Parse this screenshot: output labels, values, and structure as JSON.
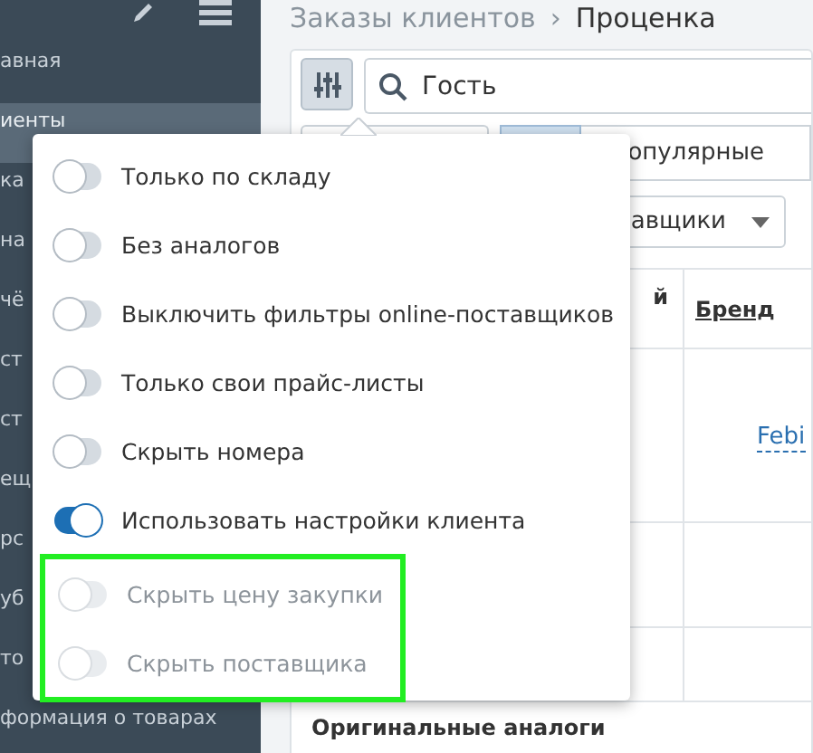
{
  "sidebar": {
    "items": [
      {
        "label": "авная",
        "selected": false
      },
      {
        "label": "иенты",
        "selected": true
      },
      {
        "label": "ка",
        "selected": false
      },
      {
        "label": "на",
        "selected": false
      },
      {
        "label": "чё",
        "selected": false
      },
      {
        "label": "ст",
        "selected": false
      },
      {
        "label": "ст",
        "selected": false
      },
      {
        "label": "ещ",
        "selected": false
      },
      {
        "label": "рс",
        "selected": false
      },
      {
        "label": "уб",
        "selected": false
      },
      {
        "label": "то",
        "selected": false
      },
      {
        "label": "формация о товарах",
        "selected": false
      }
    ]
  },
  "breadcrumb": {
    "parent": "Заказы клиентов",
    "separator": "›",
    "current": "Проценка"
  },
  "search": {
    "value": "Гость"
  },
  "tabs": [
    {
      "selected": false
    },
    {
      "selected": true
    },
    {
      "label": "опулярные",
      "selected": false
    }
  ],
  "supplier_select": {
    "value": "авщики"
  },
  "table": {
    "columns": [
      "й",
      "Бренд"
    ],
    "brand_link": "Febi",
    "section": "Оригинальные аналоги"
  },
  "menu": {
    "options": [
      {
        "label": "Только по складу",
        "on": false,
        "disabled": false
      },
      {
        "label": "Без аналогов",
        "on": false,
        "disabled": false
      },
      {
        "label": "Выключить фильтры online-поставщиков",
        "on": false,
        "disabled": false
      },
      {
        "label": "Только свои прайс-листы",
        "on": false,
        "disabled": false
      },
      {
        "label": "Скрыть номера",
        "on": false,
        "disabled": false
      },
      {
        "label": "Использовать настройки клиента",
        "on": true,
        "disabled": false
      }
    ],
    "highlighted_options": [
      {
        "label": "Скрыть цену закупки",
        "on": false,
        "disabled": true
      },
      {
        "label": "Скрыть поставщика",
        "on": false,
        "disabled": true
      }
    ]
  }
}
